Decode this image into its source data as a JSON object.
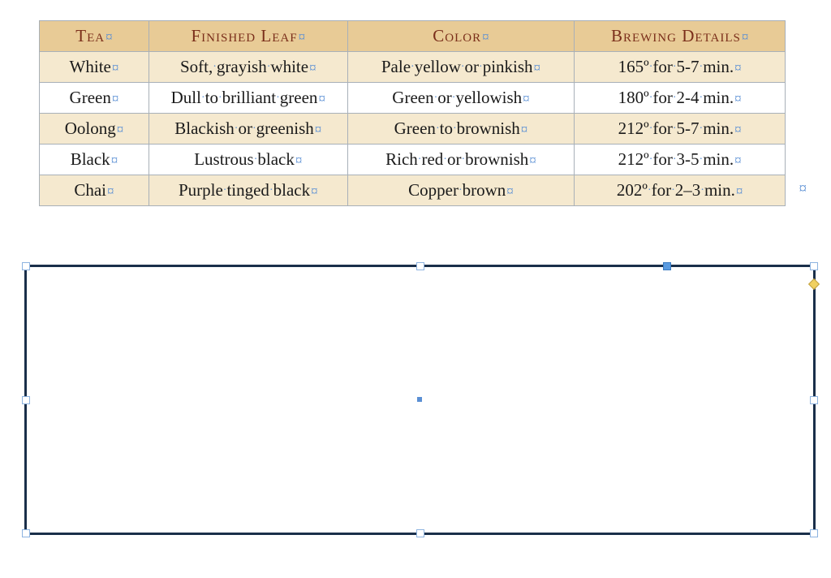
{
  "table": {
    "headers": {
      "tea": "Tea",
      "leaf": "Finished Leaf",
      "color": "Color",
      "brew": "Brewing Details"
    },
    "rows": [
      {
        "tea": "White",
        "leaf": [
          "Soft,",
          "grayish",
          "white"
        ],
        "color": [
          "Pale",
          "yellow",
          "or",
          "pinkish"
        ],
        "brew": [
          "165º",
          "for",
          "5-7",
          "min."
        ]
      },
      {
        "tea": "Green",
        "leaf": [
          "Dull",
          "to",
          "brilliant",
          "green"
        ],
        "color": [
          "Green",
          "or",
          "yellowish"
        ],
        "brew": [
          "180º",
          "for",
          "2-4",
          "min."
        ]
      },
      {
        "tea": "Oolong",
        "leaf": [
          "Blackish",
          "or",
          "greenish"
        ],
        "color": [
          "Green",
          "to",
          "brownish"
        ],
        "brew": [
          "212º",
          "for",
          "5-7",
          "min."
        ]
      },
      {
        "tea": "Black",
        "leaf": [
          "Lustrous",
          "black"
        ],
        "color": [
          "Rich",
          "red",
          "or",
          "brownish"
        ],
        "brew": [
          "212º",
          "for",
          "3-5",
          "min."
        ]
      },
      {
        "tea": "Chai",
        "leaf": [
          "Purple",
          "tinged",
          "black"
        ],
        "color": [
          "Copper",
          "brown"
        ],
        "brew": [
          "202º",
          "for",
          "2–3",
          "min."
        ]
      }
    ]
  },
  "formatting_mark": "¤",
  "space_dot": "·",
  "trailing": "¤"
}
